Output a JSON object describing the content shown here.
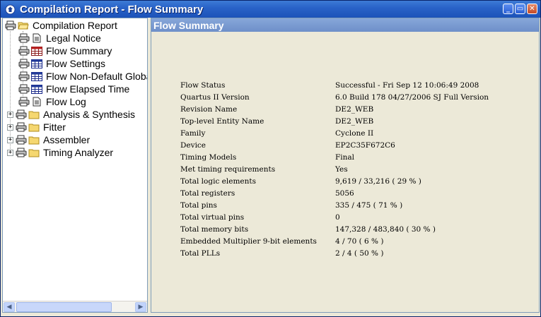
{
  "window": {
    "title": "Compilation Report - Flow Summary",
    "buttons": {
      "minimize": "_",
      "restore": "▭",
      "close": "✕"
    }
  },
  "tree": {
    "root": {
      "label": "Compilation Report",
      "icon": "folder-open-printer-icon"
    },
    "items": [
      {
        "label": "Legal Notice",
        "icon": "document-icon",
        "expandable": false
      },
      {
        "label": "Flow Summary",
        "icon": "table-icon",
        "expandable": false,
        "selected": true
      },
      {
        "label": "Flow Settings",
        "icon": "table-icon",
        "expandable": false
      },
      {
        "label": "Flow Non-Default Global",
        "icon": "table-icon",
        "expandable": false
      },
      {
        "label": "Flow Elapsed Time",
        "icon": "table-icon",
        "expandable": false
      },
      {
        "label": "Flow Log",
        "icon": "document-icon",
        "expandable": false
      },
      {
        "label": "Analysis & Synthesis",
        "icon": "folder-icon",
        "expandable": true
      },
      {
        "label": "Fitter",
        "icon": "folder-icon",
        "expandable": true
      },
      {
        "label": "Assembler",
        "icon": "folder-icon",
        "expandable": true
      },
      {
        "label": "Timing Analyzer",
        "icon": "folder-icon",
        "expandable": true
      }
    ],
    "scrollbar": {
      "left_arrow": "◀",
      "right_arrow": "▶"
    }
  },
  "report": {
    "header": "Flow Summary",
    "rows": [
      {
        "key": "Flow Status",
        "value": "Successful - Fri Sep 12 10:06:49 2008"
      },
      {
        "key": "Quartus II Version",
        "value": "6.0 Build 178 04/27/2006 SJ Full Version"
      },
      {
        "key": "Revision Name",
        "value": "DE2_WEB"
      },
      {
        "key": "Top-level Entity Name",
        "value": "DE2_WEB"
      },
      {
        "key": "Family",
        "value": "Cyclone II"
      },
      {
        "key": "Device",
        "value": "EP2C35F672C6"
      },
      {
        "key": "Timing Models",
        "value": "Final"
      },
      {
        "key": "Met timing requirements",
        "value": "Yes"
      },
      {
        "key": "Total logic elements",
        "value": "9,619 / 33,216 ( 29 % )"
      },
      {
        "key": "Total registers",
        "value": "5056"
      },
      {
        "key": "Total pins",
        "value": "335 / 475 ( 71 % )"
      },
      {
        "key": "Total virtual pins",
        "value": "0"
      },
      {
        "key": "Total memory bits",
        "value": "147,328 / 483,840 ( 30 % )"
      },
      {
        "key": "Embedded Multiplier 9-bit elements",
        "value": "4 / 70 ( 6 % )"
      },
      {
        "key": "Total PLLs",
        "value": "2 / 4 ( 50 % )"
      }
    ]
  },
  "colors": {
    "titlebar": "#2a63c8",
    "panel_bg": "#ece9d8",
    "report_header": "#7b9bd0",
    "tree_bg": "#ffffff"
  }
}
